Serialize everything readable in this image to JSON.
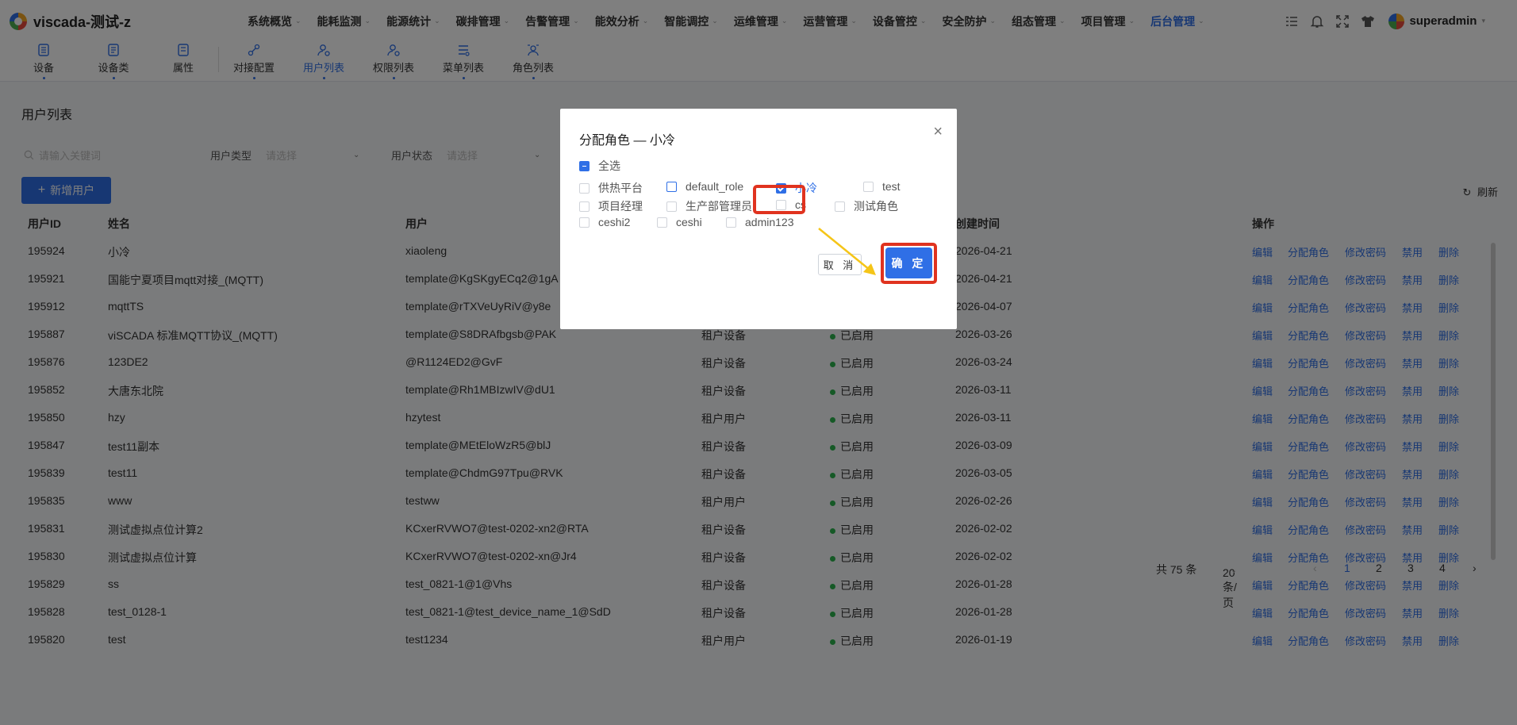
{
  "app": {
    "title": "viscada-测试-z"
  },
  "main_nav": [
    {
      "label": "系统概览"
    },
    {
      "label": "能耗监测"
    },
    {
      "label": "能源统计"
    },
    {
      "label": "碳排管理"
    },
    {
      "label": "告警管理"
    },
    {
      "label": "能效分析"
    },
    {
      "label": "智能调控"
    },
    {
      "label": "运维管理"
    },
    {
      "label": "运营管理"
    },
    {
      "label": "设备管控"
    },
    {
      "label": "安全防护"
    },
    {
      "label": "组态管理"
    },
    {
      "label": "项目管理"
    },
    {
      "label": "后台管理",
      "active": true
    }
  ],
  "user": {
    "name": "superadmin"
  },
  "sub_nav": [
    {
      "label": "设备"
    },
    {
      "label": "设备类"
    },
    {
      "label": "属性"
    },
    {
      "label": "对接配置"
    },
    {
      "label": "用户列表",
      "active": true
    },
    {
      "label": "权限列表"
    },
    {
      "label": "菜单列表"
    },
    {
      "label": "角色列表"
    }
  ],
  "page": {
    "title": "用户列表",
    "search_placeholder": "请输入关键词",
    "filter_type_label": "用户类型",
    "filter_type_placeholder": "请选择",
    "filter_status_label": "用户状态",
    "filter_status_placeholder": "请选择",
    "add_button": "新增用户",
    "refresh": "刷新"
  },
  "table": {
    "headers": {
      "id": "用户ID",
      "name": "姓名",
      "user": "用户",
      "created": "创建时间",
      "ops": "操作"
    },
    "ops": [
      "编辑",
      "分配角色",
      "修改密码",
      "禁用",
      "删除"
    ],
    "rows": [
      {
        "id": "195924",
        "name": "小冷",
        "user": "xiaoleng",
        "type": "",
        "status": "",
        "created": "2026-04-21"
      },
      {
        "id": "195921",
        "name": "国能宁夏项目mqtt对接_(MQTT)",
        "user": "template@KgSKgyECq2@1gA",
        "type": "",
        "status": "",
        "created": "2026-04-21"
      },
      {
        "id": "195912",
        "name": "mqttTS",
        "user": "template@rTXVeUyRiV@y8e",
        "type": "",
        "status": "",
        "created": "2026-04-07"
      },
      {
        "id": "195887",
        "name": "viSCADA 标准MQTT协议_(MQTT)",
        "user": "template@S8DRAfbgsb@PAK",
        "type": "租户设备",
        "status": "已启用",
        "created": "2026-03-26"
      },
      {
        "id": "195876",
        "name": "123DE2",
        "user": "@R1124ED2@GvF",
        "type": "租户设备",
        "status": "已启用",
        "created": "2026-03-24"
      },
      {
        "id": "195852",
        "name": "大唐东北院",
        "user": "template@Rh1MBIzwIV@dU1",
        "type": "租户设备",
        "status": "已启用",
        "created": "2026-03-11"
      },
      {
        "id": "195850",
        "name": "hzy",
        "user": "hzytest",
        "type": "租户用户",
        "status": "已启用",
        "created": "2026-03-11"
      },
      {
        "id": "195847",
        "name": "test11副本",
        "user": "template@MEtEloWzR5@blJ",
        "type": "租户设备",
        "status": "已启用",
        "created": "2026-03-09"
      },
      {
        "id": "195839",
        "name": "test11",
        "user": "template@ChdmG97Tpu@RVK",
        "type": "租户设备",
        "status": "已启用",
        "created": "2026-03-05"
      },
      {
        "id": "195835",
        "name": "www",
        "user": "testww",
        "type": "租户用户",
        "status": "已启用",
        "created": "2026-02-26"
      },
      {
        "id": "195831",
        "name": "测试虚拟点位计算2",
        "user": "KCxerRVWO7@test-0202-xn2@RTA",
        "type": "租户设备",
        "status": "已启用",
        "created": "2026-02-02"
      },
      {
        "id": "195830",
        "name": "测试虚拟点位计算",
        "user": "KCxerRVWO7@test-0202-xn@Jr4",
        "type": "租户设备",
        "status": "已启用",
        "created": "2026-02-02"
      },
      {
        "id": "195829",
        "name": "ss",
        "user": "test_0821-1@1@Vhs",
        "type": "租户设备",
        "status": "已启用",
        "created": "2026-01-28"
      },
      {
        "id": "195828",
        "name": "test_0128-1",
        "user": "test_0821-1@test_device_name_1@SdD",
        "type": "租户设备",
        "status": "已启用",
        "created": "2026-01-28"
      },
      {
        "id": "195820",
        "name": "test",
        "user": "test1234",
        "type": "租户用户",
        "status": "已启用",
        "created": "2026-01-19"
      }
    ]
  },
  "pager": {
    "total": "共 75 条",
    "page_size": "20条/页",
    "pages": [
      "1",
      "2",
      "3",
      "4"
    ],
    "current": "1"
  },
  "modal": {
    "title": "分配角色 — 小冷",
    "select_all": "全选",
    "roles": [
      {
        "label": "供热平台",
        "checked": false
      },
      {
        "label": "default_role",
        "checked": false
      },
      {
        "label": "小冷",
        "checked": true
      },
      {
        "label": "test",
        "checked": false
      },
      {
        "label": "项目经理",
        "checked": false
      },
      {
        "label": "生产部管理员",
        "checked": false
      },
      {
        "label": "cs",
        "checked": false
      },
      {
        "label": "测试角色",
        "checked": false
      },
      {
        "label": "ceshi2",
        "checked": false
      },
      {
        "label": "ceshi",
        "checked": false
      },
      {
        "label": "admin123",
        "checked": false
      }
    ],
    "cancel": "取 消",
    "ok": "确 定"
  },
  "colors": {
    "accent": "#2f6fe6",
    "highlight": "#e0331f",
    "arrow": "#f5c518",
    "status_green": "#2bb24c"
  }
}
